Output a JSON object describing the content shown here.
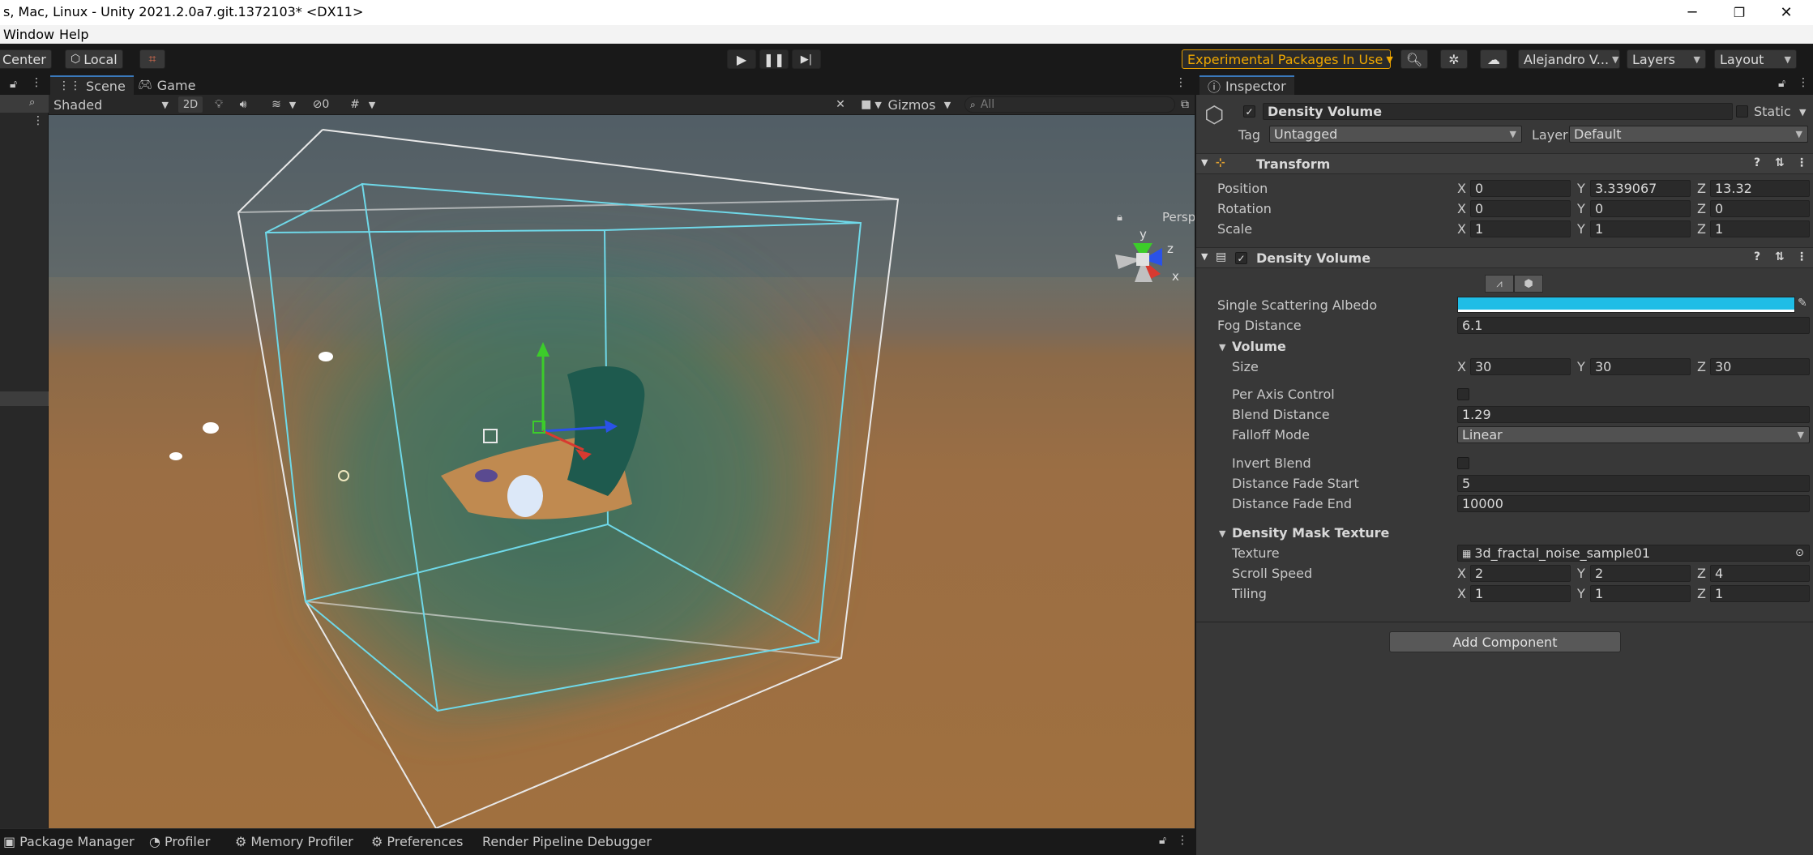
{
  "window": {
    "title": "s, Mac, Linux - Unity 2021.2.0a7.git.1372103* <DX11>",
    "controls": {
      "minimize": "─",
      "maximize": "❐",
      "close": "✕"
    }
  },
  "menu": {
    "items": [
      "Window",
      "Help"
    ]
  },
  "toolbar": {
    "pivot_label": "Center",
    "space_label": "Local",
    "experimental_label": "Experimental Packages In Use",
    "account_label": "Alejandro V...",
    "layers_label": "Layers",
    "layout_label": "Layout"
  },
  "scene": {
    "tabs": [
      "Scene",
      "Game"
    ],
    "draw_mode": "Shaded",
    "mode_2d": "2D",
    "hidden_count": "0",
    "gizmos_label": "Gizmos",
    "search_placeholder": "All",
    "axis_labels": {
      "y": "y",
      "z": "z",
      "x": "x"
    },
    "persp_label": "Persp"
  },
  "bottom_tabs": [
    "Package Manager",
    "Profiler",
    "Memory Profiler",
    "Preferences",
    "Render Pipeline Debugger"
  ],
  "inspector": {
    "tab_label": "Inspector",
    "object_name": "Density Volume",
    "static_label": "Static",
    "tag_label": "Tag",
    "tag_value": "Untagged",
    "layer_label": "Layer",
    "layer_value": "Default",
    "transform": {
      "title": "Transform",
      "rows": [
        {
          "label": "Position",
          "x": "0",
          "y": "3.339067",
          "z": "13.32"
        },
        {
          "label": "Rotation",
          "x": "0",
          "y": "0",
          "z": "0"
        },
        {
          "label": "Scale",
          "x": "1",
          "y": "1",
          "z": "1"
        }
      ]
    },
    "density_volume": {
      "title": "Density Volume",
      "albedo_label": "Single Scattering Albedo",
      "albedo_color": "#1fbde6",
      "fog_distance_label": "Fog Distance",
      "fog_distance_value": "6.1",
      "volume_header": "Volume",
      "size_label": "Size",
      "size": {
        "x": "30",
        "y": "30",
        "z": "30"
      },
      "per_axis_label": "Per Axis Control",
      "blend_distance_label": "Blend Distance",
      "blend_distance_value": "1.29",
      "falloff_label": "Falloff Mode",
      "falloff_value": "Linear",
      "invert_blend_label": "Invert Blend",
      "fade_start_label": "Distance Fade Start",
      "fade_start_value": "5",
      "fade_end_label": "Distance Fade End",
      "fade_end_value": "10000",
      "mask_header": "Density Mask Texture",
      "texture_label": "Texture",
      "texture_value": "3d_fractal_noise_sample01",
      "scroll_label": "Scroll Speed",
      "scroll": {
        "x": "2",
        "y": "2",
        "z": "4"
      },
      "tiling_label": "Tiling",
      "tiling": {
        "x": "1",
        "y": "1",
        "z": "1"
      }
    },
    "add_component_label": "Add Component",
    "axis": {
      "x": "X",
      "y": "Y",
      "z": "Z"
    }
  }
}
